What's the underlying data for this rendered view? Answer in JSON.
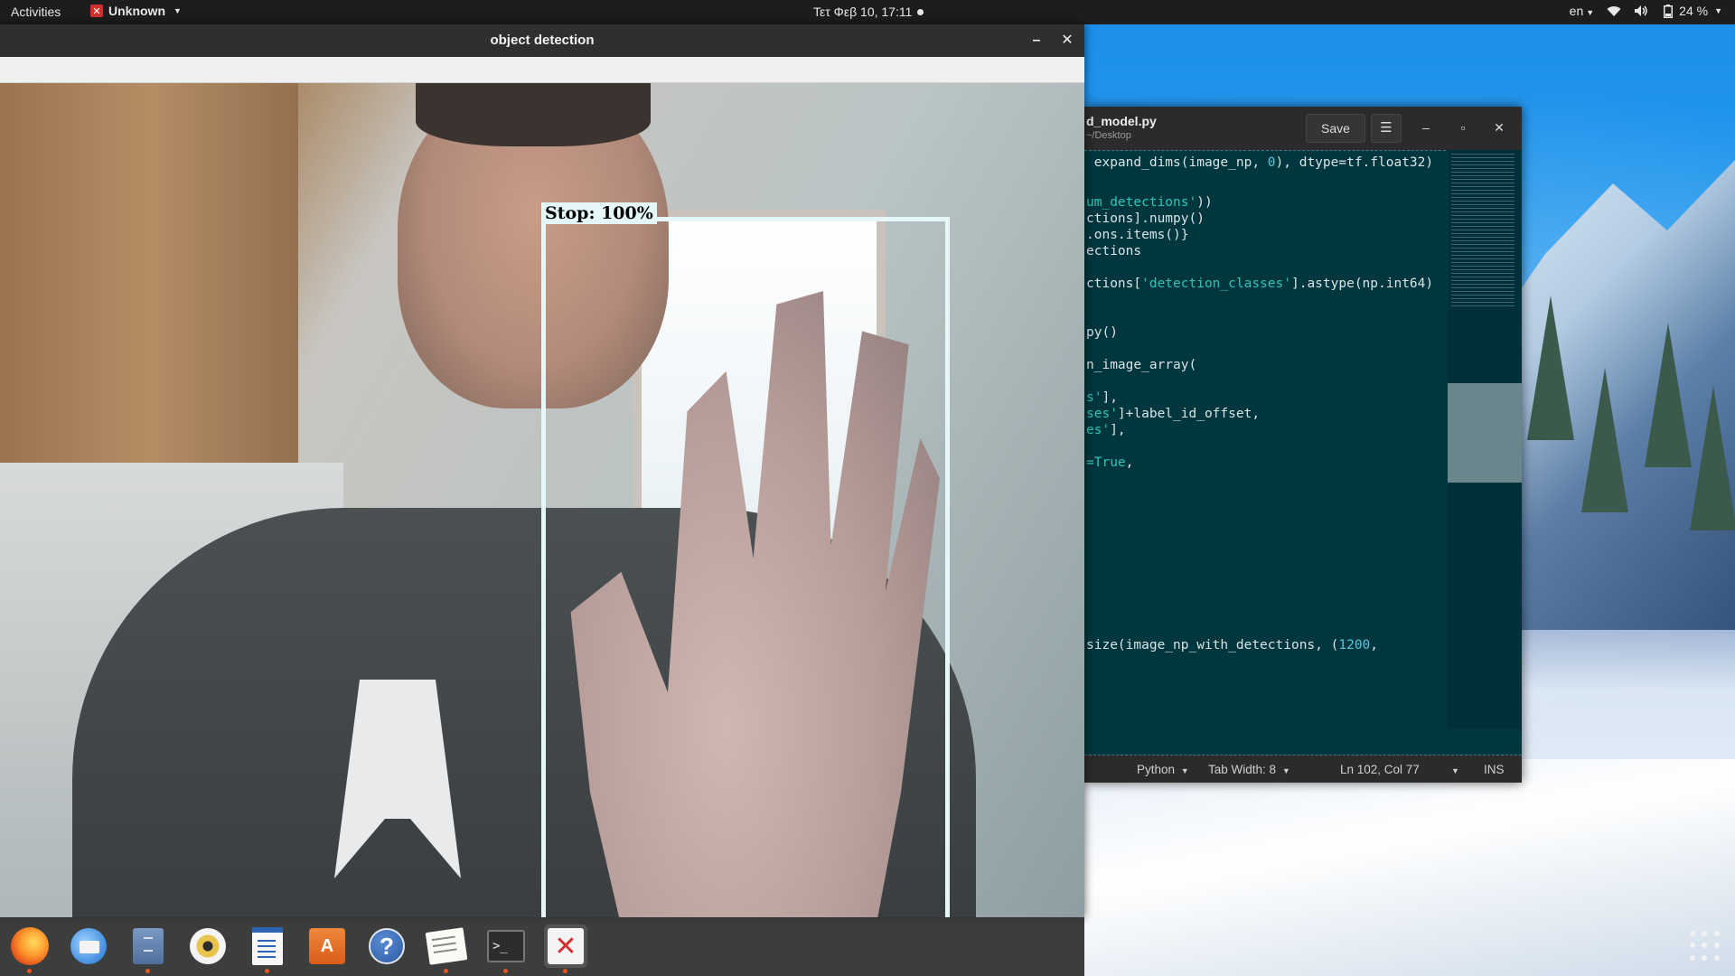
{
  "topbar": {
    "activities": "Activities",
    "app_menu": "Unknown",
    "clock": "Τετ Φεβ 10, 17:11",
    "language": "en",
    "battery": "24 %"
  },
  "object_detection_window": {
    "title": "object detection",
    "detection_label": "Stop: 100%"
  },
  "editor": {
    "filename": "d_model.py",
    "path": "~/Desktop",
    "save_label": "Save",
    "code_lines": [
      {
        "pre": " expand_dims(image_np, ",
        "num": "0",
        "post": "), dtype=tf.float32)"
      },
      {
        "str": "um_detections'",
        "post": "))"
      },
      {
        "post": "ctions].numpy()"
      },
      {
        "post": ".ons.items()}"
      },
      {
        "post": "ections"
      },
      {
        "pre": "ctions[",
        "str": "'detection_classes'",
        "post": "].astype(np.int64)"
      },
      {
        "post": "py()"
      },
      {
        "post": "n_image_array("
      },
      {
        "str": "s'",
        "post": "],"
      },
      {
        "str": "ses'",
        "post": "]+label_id_offset,"
      },
      {
        "str": "es'",
        "post": "],"
      },
      {
        "str": "=True",
        "post": ","
      },
      {
        "pre": "size(image_np_with_detections, (",
        "num": "1200",
        "post": ","
      }
    ],
    "status": {
      "language": "Python",
      "tab_width": "Tab Width: 8",
      "position": "Ln 102, Col 77",
      "mode": "INS"
    }
  },
  "dock": {
    "items": [
      {
        "name": "firefox",
        "icon": "firefox-icon"
      },
      {
        "name": "thunderbird",
        "icon": "mail-icon"
      },
      {
        "name": "files",
        "icon": "files-icon"
      },
      {
        "name": "rhythmbox",
        "icon": "music-icon"
      },
      {
        "name": "writer",
        "icon": "writer-icon"
      },
      {
        "name": "software",
        "icon": "store-icon"
      },
      {
        "name": "help",
        "icon": "help-icon"
      },
      {
        "name": "text-editor",
        "icon": "editor-icon"
      },
      {
        "name": "terminal",
        "icon": "terminal-icon"
      },
      {
        "name": "unknown-app",
        "icon": "app-icon"
      }
    ]
  }
}
